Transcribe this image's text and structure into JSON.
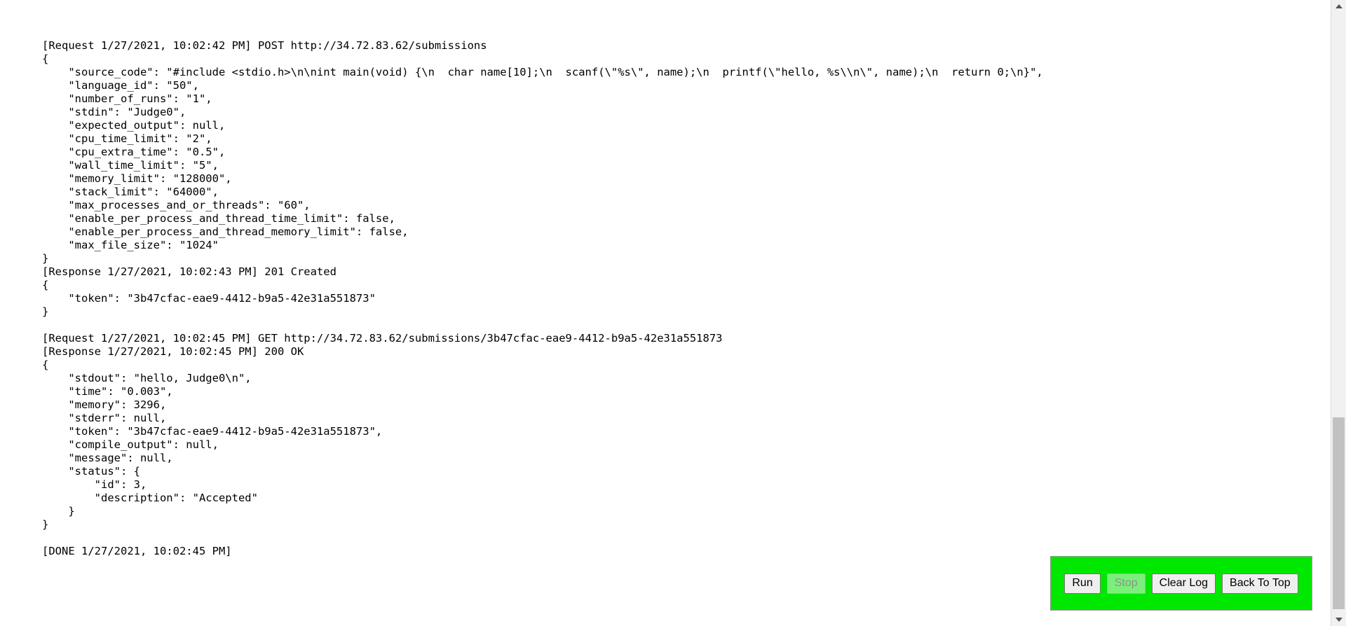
{
  "log": {
    "lines": [
      "[Request 1/27/2021, 10:02:42 PM] POST http://34.72.83.62/submissions",
      "{",
      "    \"source_code\": \"#include <stdio.h>\\n\\nint main(void) {\\n  char name[10];\\n  scanf(\\\"%s\\\", name);\\n  printf(\\\"hello, %s\\\\n\\\", name);\\n  return 0;\\n}\",",
      "    \"language_id\": \"50\",",
      "    \"number_of_runs\": \"1\",",
      "    \"stdin\": \"Judge0\",",
      "    \"expected_output\": null,",
      "    \"cpu_time_limit\": \"2\",",
      "    \"cpu_extra_time\": \"0.5\",",
      "    \"wall_time_limit\": \"5\",",
      "    \"memory_limit\": \"128000\",",
      "    \"stack_limit\": \"64000\",",
      "    \"max_processes_and_or_threads\": \"60\",",
      "    \"enable_per_process_and_thread_time_limit\": false,",
      "    \"enable_per_process_and_thread_memory_limit\": false,",
      "    \"max_file_size\": \"1024\"",
      "}",
      "[Response 1/27/2021, 10:02:43 PM] 201 Created",
      "{",
      "    \"token\": \"3b47cfac-eae9-4412-b9a5-42e31a551873\"",
      "}",
      "",
      "[Request 1/27/2021, 10:02:45 PM] GET http://34.72.83.62/submissions/3b47cfac-eae9-4412-b9a5-42e31a551873",
      "[Response 1/27/2021, 10:02:45 PM] 200 OK",
      "{",
      "    \"stdout\": \"hello, Judge0\\n\",",
      "    \"time\": \"0.003\",",
      "    \"memory\": 3296,",
      "    \"stderr\": null,",
      "    \"token\": \"3b47cfac-eae9-4412-b9a5-42e31a551873\",",
      "    \"compile_output\": null,",
      "    \"message\": null,",
      "    \"status\": {",
      "        \"id\": 3,",
      "        \"description\": \"Accepted\"",
      "    }",
      "}",
      "",
      "[DONE 1/27/2021, 10:02:45 PM]"
    ]
  },
  "control_bar": {
    "background_color": "#00e800",
    "buttons": [
      {
        "label": "Run",
        "name": "run-button",
        "disabled": false
      },
      {
        "label": "Stop",
        "name": "stop-button",
        "disabled": true
      },
      {
        "label": "Clear Log",
        "name": "clear-log-button",
        "disabled": false
      },
      {
        "label": "Back To Top",
        "name": "back-to-top-button",
        "disabled": false
      }
    ]
  },
  "scrollbar": {
    "up_arrow": "scroll-up-arrow",
    "down_arrow": "scroll-down-arrow",
    "thumb": "scroll-thumb"
  }
}
